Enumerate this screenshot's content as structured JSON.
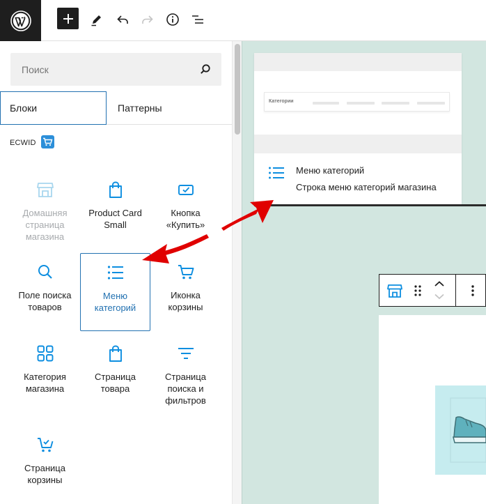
{
  "toolbar": {
    "logo_icon": "wordpress-logo-icon",
    "add_icon": "plus-icon",
    "tools_icon": "pencil-icon",
    "undo_icon": "undo-icon",
    "redo_icon": "redo-icon",
    "info_icon": "info-icon",
    "list_view_icon": "list-view-icon"
  },
  "sidebar": {
    "search": {
      "placeholder": "Поиск",
      "value": ""
    },
    "tabs": [
      {
        "label": "Блоки",
        "active": true
      },
      {
        "label": "Паттерны",
        "active": false
      }
    ],
    "category": {
      "label": "ECWID",
      "icon": "ecwid-cart-icon"
    },
    "blocks": [
      {
        "label": "Домашняя\nстраница\nмагазина",
        "icon": "store-icon",
        "disabled": true,
        "selected": false
      },
      {
        "label": "Product Card\nSmall",
        "icon": "shopping-bag-icon",
        "disabled": false,
        "selected": false
      },
      {
        "label": "Кнопка\n«Купить»",
        "icon": "buy-button-icon",
        "disabled": false,
        "selected": false
      },
      {
        "label": "Поле поиска\nтоваров",
        "icon": "search-icon",
        "disabled": false,
        "selected": false
      },
      {
        "label": "Меню\nкатегорий",
        "icon": "list-icon",
        "disabled": false,
        "selected": true
      },
      {
        "label": "Иконка\nкорзины",
        "icon": "cart-icon",
        "disabled": false,
        "selected": false
      },
      {
        "label": "Категория\nмагазина",
        "icon": "category-grid-icon",
        "disabled": false,
        "selected": false
      },
      {
        "label": "Страница\nтовара",
        "icon": "shopping-bag-icon",
        "disabled": false,
        "selected": false
      },
      {
        "label": "Страница\nпоиска и\nфильтров",
        "icon": "filter-icon",
        "disabled": false,
        "selected": false
      },
      {
        "label": "Страница\nкорзины",
        "icon": "cart-check-icon",
        "disabled": false,
        "selected": false
      }
    ]
  },
  "preview": {
    "category_label": "Категории",
    "title": "Меню категорий",
    "description": "Строка меню категорий магазина"
  },
  "block_toolbar": {
    "block_icon": "store-icon",
    "drag_icon": "drag-handle-icon",
    "move_up_icon": "chevron-up-icon",
    "move_down_icon": "chevron-down-icon",
    "options_icon": "more-vertical-icon"
  },
  "colors": {
    "accent": "#2271b1",
    "ecwid_blue": "#0d8ee0",
    "canvas_bg": "#d2e6e0",
    "annotation_arrow": "#e00000"
  }
}
